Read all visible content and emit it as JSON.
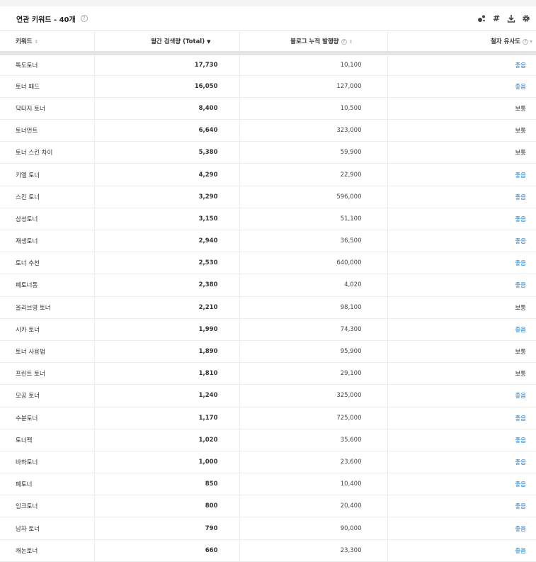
{
  "header": {
    "title": "연관 키워드 - 40개",
    "help": "?"
  },
  "toolbar": {
    "icons": [
      "bubble-chart-icon",
      "hashtag-icon",
      "download-icon",
      "gear-icon"
    ],
    "hash_glyph": "#"
  },
  "columns": {
    "keyword": "키워드",
    "monthly": "월간 검색량 (Total)",
    "blog": "블로그 누적 발행량",
    "similarity": "철자 유사도"
  },
  "colors": {
    "good": "#1a7fd4",
    "normal": "#333333"
  },
  "rows": [
    {
      "keyword": "톡도토너",
      "monthly": "17,730",
      "blog": "10,100",
      "sim": "좋음"
    },
    {
      "keyword": "토너 패드",
      "monthly": "16,050",
      "blog": "127,000",
      "sim": "좋음"
    },
    {
      "keyword": "닥터지 토너",
      "monthly": "8,400",
      "blog": "10,500",
      "sim": "보통"
    },
    {
      "keyword": "토너먼트",
      "monthly": "6,640",
      "blog": "323,000",
      "sim": "보통"
    },
    {
      "keyword": "토너 스킨 차이",
      "monthly": "5,380",
      "blog": "59,900",
      "sim": "보통"
    },
    {
      "keyword": "키엘 토너",
      "monthly": "4,290",
      "blog": "22,900",
      "sim": "좋음"
    },
    {
      "keyword": "스킨 토너",
      "monthly": "3,290",
      "blog": "596,000",
      "sim": "좋음"
    },
    {
      "keyword": "삼성토너",
      "monthly": "3,150",
      "blog": "51,100",
      "sim": "좋음"
    },
    {
      "keyword": "재생토너",
      "monthly": "2,940",
      "blog": "36,500",
      "sim": "좋음"
    },
    {
      "keyword": "토너 추천",
      "monthly": "2,530",
      "blog": "640,000",
      "sim": "좋음"
    },
    {
      "keyword": "폐토너통",
      "monthly": "2,380",
      "blog": "4,020",
      "sim": "좋음"
    },
    {
      "keyword": "올리브영 토너",
      "monthly": "2,210",
      "blog": "98,100",
      "sim": "보통"
    },
    {
      "keyword": "시카 토너",
      "monthly": "1,990",
      "blog": "74,300",
      "sim": "좋음"
    },
    {
      "keyword": "토너 사용법",
      "monthly": "1,890",
      "blog": "95,900",
      "sim": "보통"
    },
    {
      "keyword": "프린트 토너",
      "monthly": "1,810",
      "blog": "29,100",
      "sim": "보통"
    },
    {
      "keyword": "모공 토너",
      "monthly": "1,240",
      "blog": "325,000",
      "sim": "좋음"
    },
    {
      "keyword": "수분토너",
      "monthly": "1,170",
      "blog": "725,000",
      "sim": "좋음"
    },
    {
      "keyword": "토너팩",
      "monthly": "1,020",
      "blog": "35,600",
      "sim": "좋음"
    },
    {
      "keyword": "바하토너",
      "monthly": "1,000",
      "blog": "23,600",
      "sim": "좋음"
    },
    {
      "keyword": "폐토너",
      "monthly": "850",
      "blog": "10,400",
      "sim": "좋음"
    },
    {
      "keyword": "잉크토너",
      "monthly": "800",
      "blog": "20,400",
      "sim": "좋음"
    },
    {
      "keyword": "남자 토너",
      "monthly": "790",
      "blog": "90,000",
      "sim": "좋음"
    },
    {
      "keyword": "캐논토너",
      "monthly": "660",
      "blog": "23,300",
      "sim": "좋음"
    }
  ]
}
